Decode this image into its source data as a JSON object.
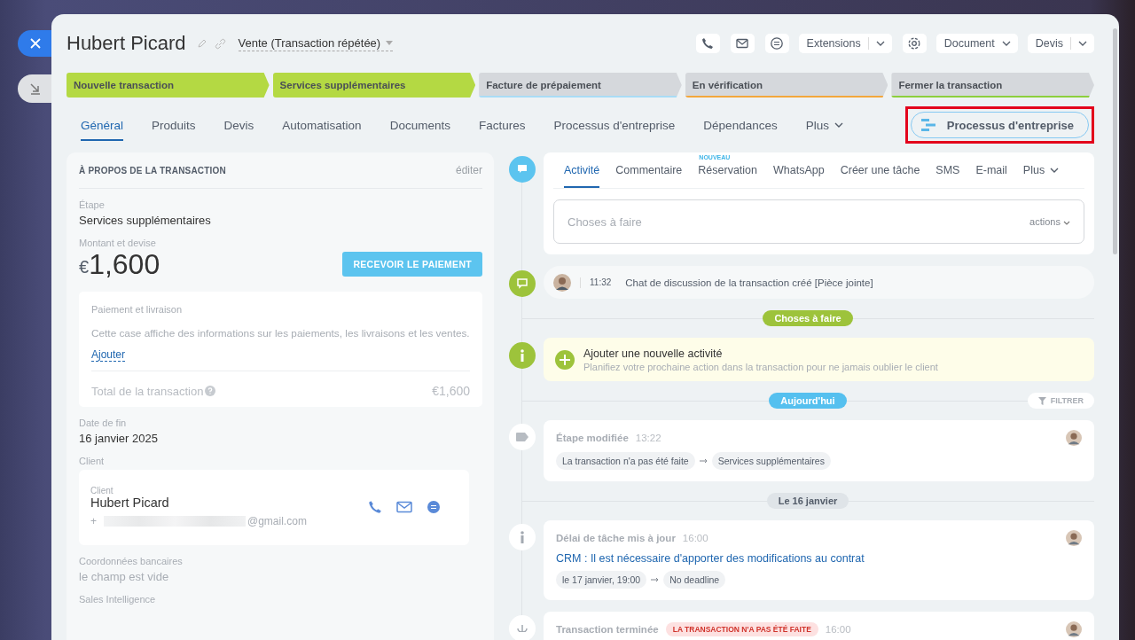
{
  "header": {
    "title": "Hubert Picard",
    "category": "Vente (Transaction répétée)",
    "buttons": [
      {
        "label": "Extensions",
        "kind": "split"
      },
      {
        "label": "Document",
        "kind": "dropdown"
      },
      {
        "label": "Devis",
        "kind": "split"
      }
    ]
  },
  "stages": [
    {
      "label": "Nouvelle transaction",
      "done": true,
      "color": "#b4d943"
    },
    {
      "label": "Services supplémentaires",
      "done": true,
      "color": "#b4d943"
    },
    {
      "label": "Facture de prépaiement",
      "done": false,
      "color": "#a9dcf5"
    },
    {
      "label": "En vérification",
      "done": false,
      "color": "#f3a73c"
    },
    {
      "label": "Fermer la transaction",
      "done": false,
      "color": "#8ccf3d"
    }
  ],
  "tabs": [
    {
      "label": "Général",
      "selected": true,
      "kind": "tab"
    },
    {
      "label": "Produits",
      "selected": false,
      "kind": "tab"
    },
    {
      "label": "Devis",
      "selected": false,
      "kind": "tab"
    },
    {
      "label": "Automatisation",
      "selected": false,
      "kind": "tab"
    },
    {
      "label": "Documents",
      "selected": false,
      "kind": "tab"
    },
    {
      "label": "Factures",
      "selected": false,
      "kind": "tab"
    },
    {
      "label": "Processus d'entreprise",
      "selected": false,
      "kind": "tab"
    },
    {
      "label": "Dépendances",
      "selected": false,
      "kind": "tab"
    },
    {
      "label": "Plus",
      "selected": false,
      "kind": "more"
    }
  ],
  "process_button": {
    "label": "Processus d'entreprise",
    "highlighted": true
  },
  "about": {
    "title": "À PROPOS DE LA TRANSACTION",
    "edit_link": "éditer",
    "stage": {
      "label": "Étape",
      "value": "Services supplémentaires"
    },
    "amount": {
      "label": "Montant et devise",
      "currency": "€",
      "value": "1,600",
      "button": "RECEVOIR LE PAIEMENT"
    },
    "payment": {
      "title": "Paiement et livraison",
      "description": "Cette case affiche des informations sur les paiements, les livraisons et les ventes.",
      "add_link": "Ajouter",
      "total_label": "Total de la transaction",
      "total_value": "€1,600"
    },
    "end_date": {
      "label": "Date de fin",
      "value": "16 janvier 2025"
    },
    "client": {
      "label": "Client",
      "card_label": "Client",
      "name": "Hubert Picard",
      "phone": "+",
      "email": "@gmail.com"
    },
    "bank": {
      "label": "Coordonnées bancaires",
      "value": "le champ est vide"
    },
    "sales": {
      "label": "Sales Intelligence"
    }
  },
  "composer": {
    "tabs": [
      {
        "label": "Activité",
        "selected": true,
        "kind": "tab"
      },
      {
        "label": "Commentaire",
        "selected": false,
        "kind": "tab"
      },
      {
        "label": "Réservation",
        "selected": false,
        "kind": "tab",
        "badge": "NOUVEAU"
      },
      {
        "label": "WhatsApp",
        "selected": false,
        "kind": "tab"
      },
      {
        "label": "Créer une tâche",
        "selected": false,
        "kind": "tab"
      },
      {
        "label": "SMS",
        "selected": false,
        "kind": "tab"
      },
      {
        "label": "E-mail",
        "selected": false,
        "kind": "tab"
      },
      {
        "label": "Plus",
        "selected": false,
        "kind": "more"
      }
    ],
    "placeholder": "Choses à faire",
    "actions": "actions"
  },
  "timeline": [
    {
      "kind": "chat",
      "time": "11:32",
      "text": "Chat de discussion de la transaction créé [Pièce jointe]"
    },
    {
      "kind": "divider",
      "label": "Choses à faire",
      "color": "#9dc33b"
    },
    {
      "kind": "todo",
      "title": "Ajouter une nouvelle activité",
      "text": "Planifiez votre prochaine action dans la transaction pour ne jamais oublier le client"
    },
    {
      "kind": "divider",
      "label": "Aujourd'hui",
      "color": "#55c0ef",
      "filter": "FILTRER"
    },
    {
      "kind": "stage",
      "title": "Étape modifiée",
      "time": "13:22",
      "chips": [
        "La transaction n'a pas été faite",
        "Services supplémentaires"
      ]
    },
    {
      "kind": "divider",
      "label": "Le 16 janvier",
      "color": "#dfe4e8"
    },
    {
      "kind": "info",
      "title": "Délai de tâche mis à jour",
      "time": "16:00",
      "link": "CRM : Il est nécessaire d'apporter des modifications au contrat",
      "chips": [
        "le 17 janvier, 19:00",
        "No deadline"
      ]
    },
    {
      "kind": "closed",
      "title": "Transaction terminée",
      "badge": "LA TRANSACTION N'A PAS ÉTÉ FAITE",
      "time": "16:00"
    }
  ]
}
